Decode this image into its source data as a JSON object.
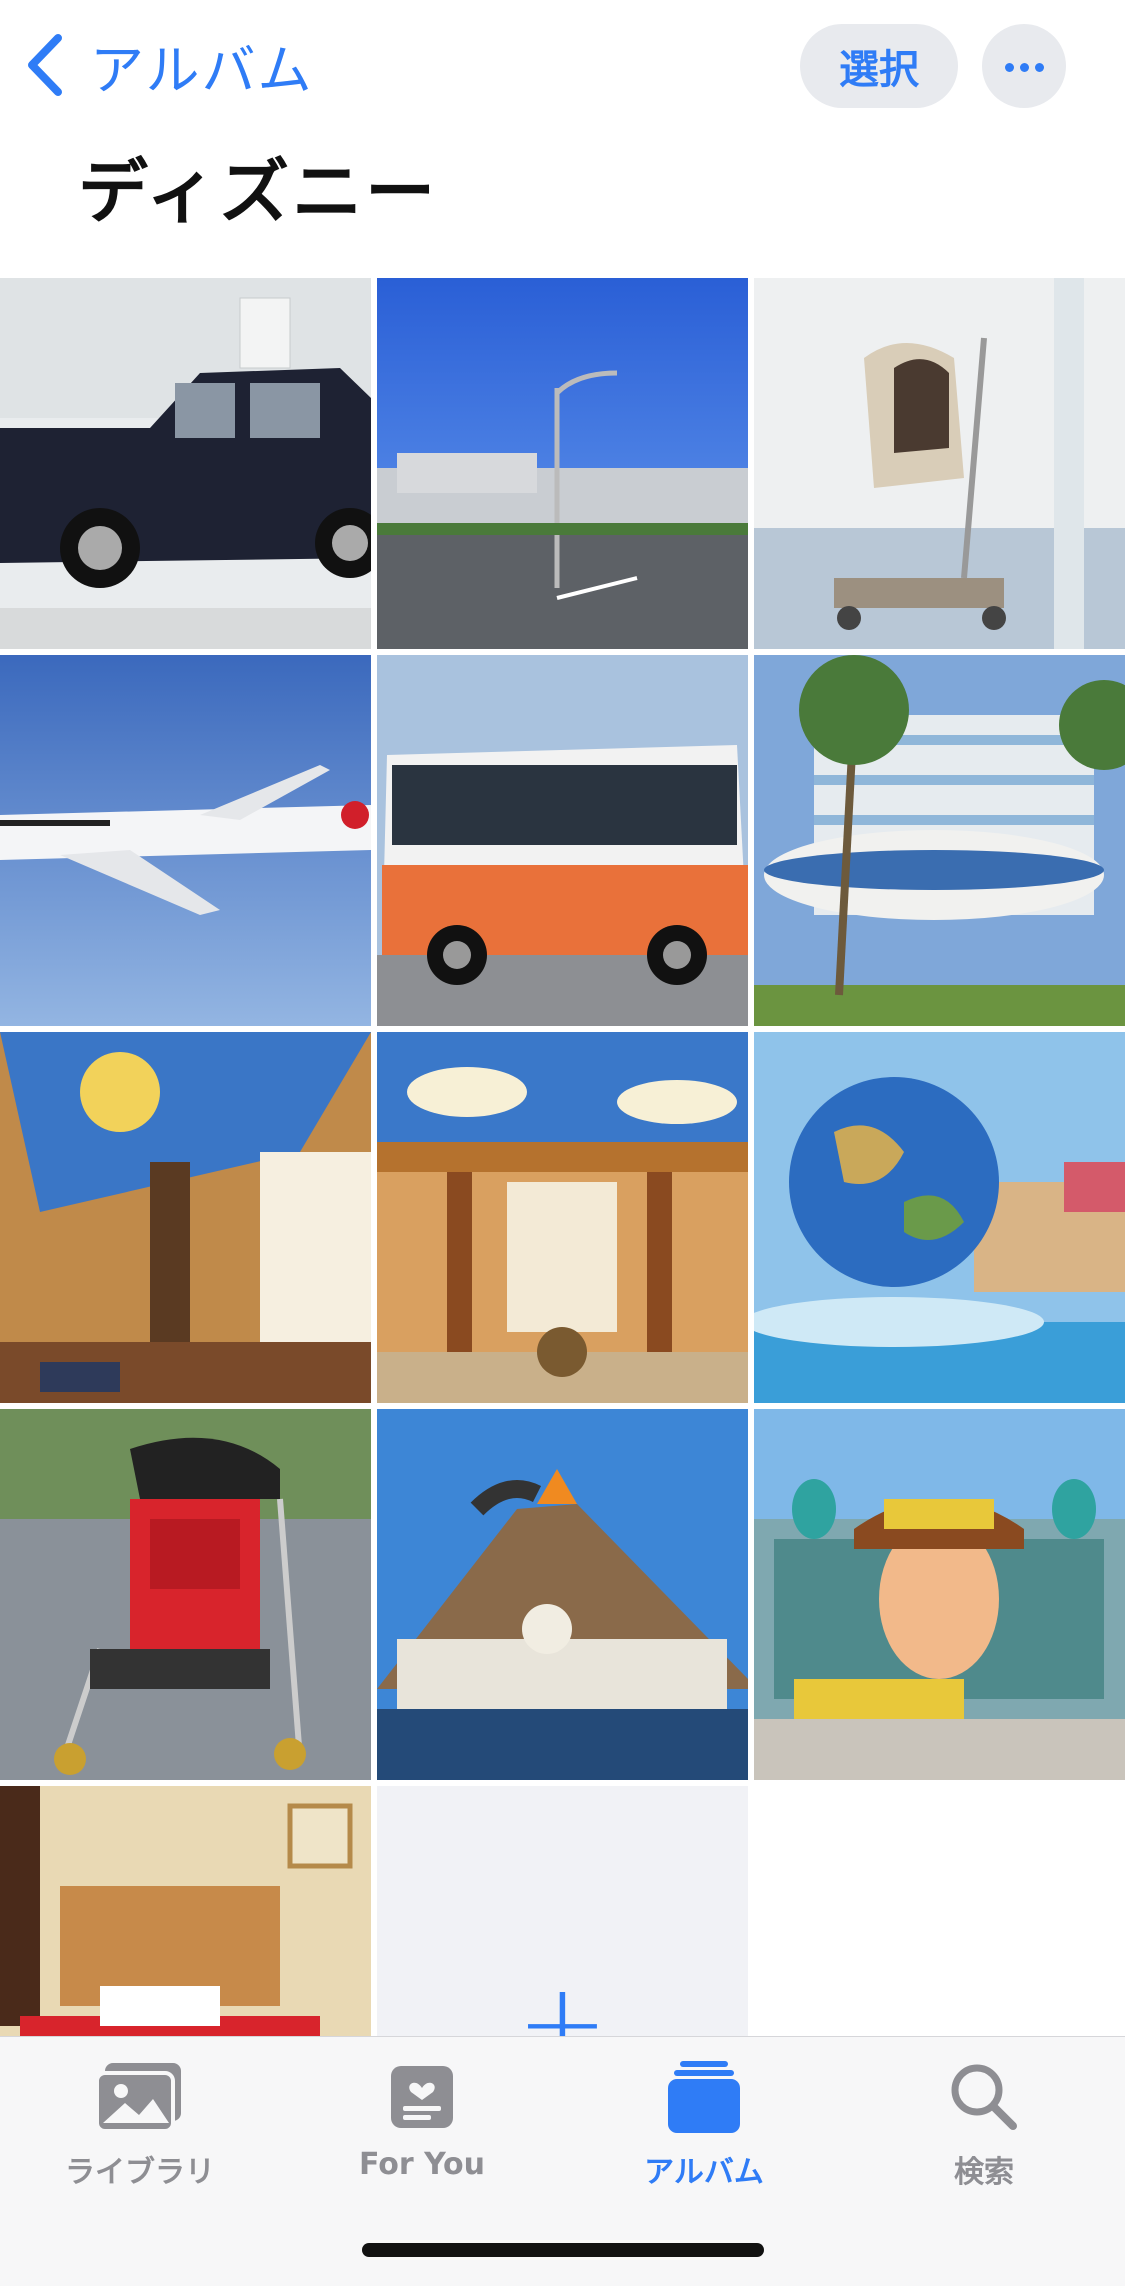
{
  "nav": {
    "back_label": "アルバム",
    "select_label": "選択"
  },
  "album": {
    "title": "ディズニー"
  },
  "photos": [
    {
      "name": "photo-taxi",
      "kind": "taxi"
    },
    {
      "name": "photo-airport-road",
      "kind": "airport"
    },
    {
      "name": "photo-baby-cart",
      "kind": "babycart"
    },
    {
      "name": "photo-airplane",
      "kind": "airplane"
    },
    {
      "name": "photo-limousine-bus",
      "kind": "bus"
    },
    {
      "name": "photo-hotel-exterior",
      "kind": "hotel"
    },
    {
      "name": "photo-hotel-lobby-1",
      "kind": "lobby1"
    },
    {
      "name": "photo-hotel-lobby-2",
      "kind": "lobby2"
    },
    {
      "name": "photo-aquasphere",
      "kind": "globe"
    },
    {
      "name": "photo-stroller",
      "kind": "stroller"
    },
    {
      "name": "photo-volcano",
      "kind": "volcano"
    },
    {
      "name": "photo-toy-story-mania",
      "kind": "toystory"
    },
    {
      "name": "photo-hotel-room",
      "kind": "room"
    }
  ],
  "add_cell": {
    "icon": "plus-icon",
    "label": "+"
  },
  "tabs": [
    {
      "label": "ライブラリ",
      "icon": "library-icon",
      "active": false
    },
    {
      "label": "For You",
      "icon": "for-you-icon",
      "active": false
    },
    {
      "label": "アルバム",
      "icon": "albums-icon",
      "active": true
    },
    {
      "label": "検索",
      "icon": "search-icon",
      "active": false
    }
  ],
  "colors": {
    "accent": "#2f7cf6",
    "inactive": "#8e8e93",
    "pill_bg": "#e8eaee"
  }
}
